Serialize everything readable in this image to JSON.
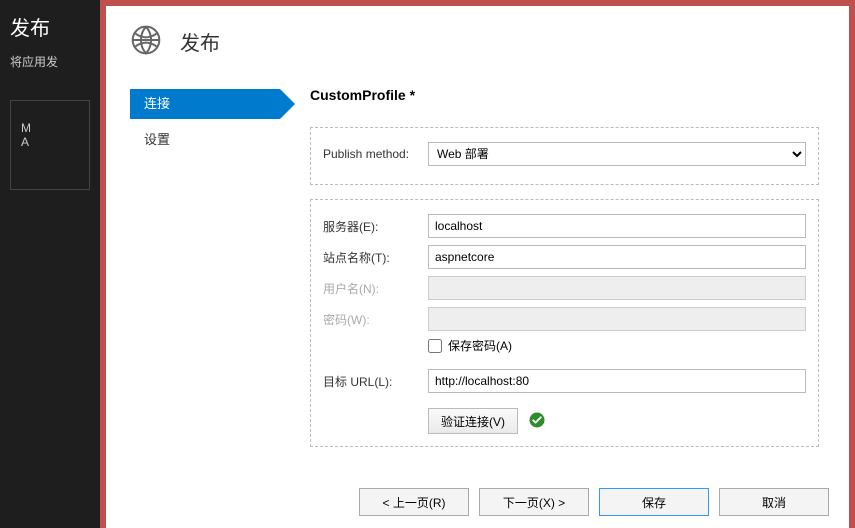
{
  "background": {
    "title": "发布",
    "subtitle": "将应用发",
    "box_line1": "M",
    "box_line2": "A"
  },
  "dialog": {
    "title": "发布",
    "nav": {
      "connect": "连接",
      "settings": "设置"
    },
    "profile_title": "CustomProfile *",
    "publish_method_label": "Publish method:",
    "publish_method_value": "Web 部署",
    "server_label": "服务器(E):",
    "server_value": "localhost",
    "site_label": "站点名称(T):",
    "site_value": "aspnetcore",
    "user_label": "用户名(N):",
    "user_value": "",
    "password_label": "密码(W):",
    "password_value": "",
    "save_password_label": "保存密码(A)",
    "desturl_label": "目标 URL(L):",
    "desturl_value": "http://localhost:80",
    "validate_label": "验证连接(V)",
    "buttons": {
      "prev": "< 上一页(R)",
      "next": "下一页(X) >",
      "save": "保存",
      "cancel": "取消"
    }
  }
}
